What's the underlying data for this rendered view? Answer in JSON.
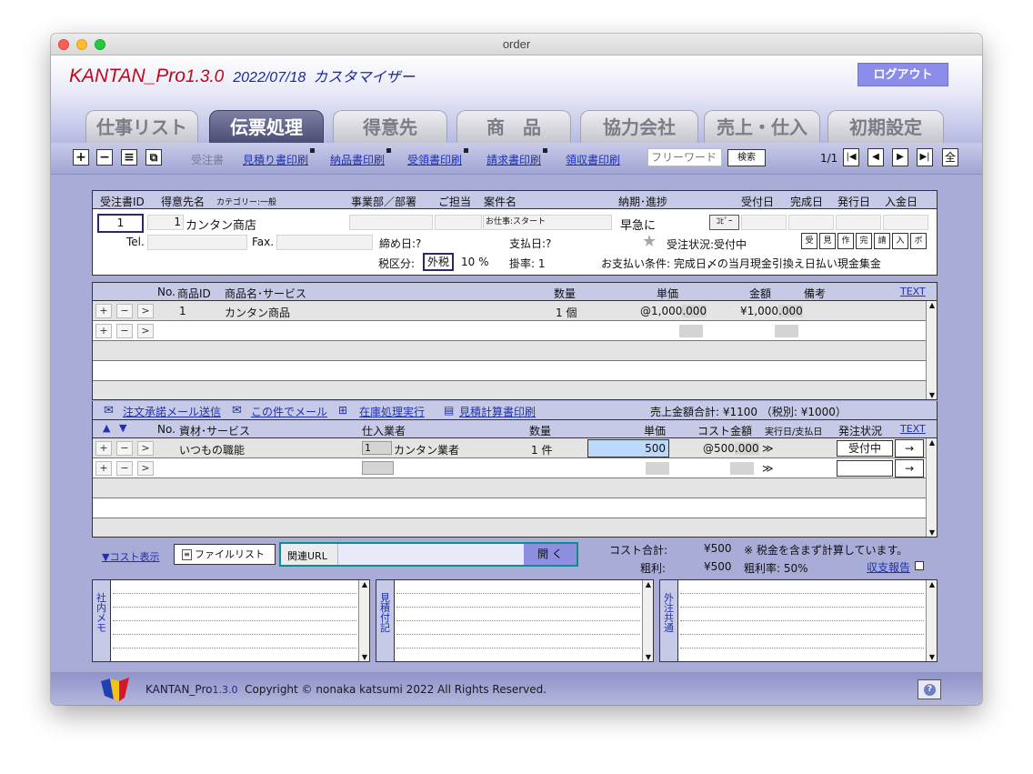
{
  "window": {
    "title": "order"
  },
  "header": {
    "app_name": "KANTAN_Pro",
    "version": "1.3.0",
    "date": "2022/07/18",
    "edition": "カスタマイザー",
    "logout_label": "ログアウト"
  },
  "tabs": [
    {
      "label": "仕事リスト",
      "active": false
    },
    {
      "label": "伝票処理",
      "active": true
    },
    {
      "label": "得意先",
      "active": false
    },
    {
      "label": "商　品",
      "active": false
    },
    {
      "label": "協力会社",
      "active": false
    },
    {
      "label": "売上・仕入",
      "active": false
    },
    {
      "label": "初期設定",
      "active": false
    }
  ],
  "toolbar": {
    "plus": "+",
    "minus": "−",
    "list": "≡",
    "copy": "⧉",
    "order_label": "受注書",
    "links": [
      "見積り書印刷",
      "納品書印刷",
      "受領書印刷",
      "請求書印刷",
      "領収書印刷"
    ],
    "freeword_placeholder": "フリーワード",
    "search_label": "検索",
    "page_info": "1/1",
    "nav_first": "|◀",
    "nav_prev": "◀",
    "nav_next": "▶",
    "nav_last": "▶|",
    "all_label": "全"
  },
  "order": {
    "header": {
      "order_id": "受注書ID",
      "customer": "得意先名",
      "category": "カテゴリー:一般",
      "dept": "事業部／部署",
      "person": "ご担当",
      "case": "案件名",
      "due": "納期･進捗",
      "received": "受付日",
      "completed": "完成日",
      "issued": "発行日",
      "paid": "入金日"
    },
    "order_id_value": "1",
    "customer_id": "1",
    "customer_name": "カンタン商店",
    "case_name": "お仕事:スタート",
    "due_value": "早急に",
    "copy_label": "ｺﾋﾟｰ",
    "tel_label": "Tel.",
    "fax_label": "Fax.",
    "closing_label": "締め日:?",
    "payment_day_label": "支払日:?",
    "status_label": "受注状況:受付中",
    "status_buttons": [
      "受",
      "見",
      "作",
      "完",
      "請",
      "入",
      "ボ"
    ],
    "tax_label": "税区分:",
    "tax_value": "外税",
    "tax_rate": "10 %",
    "rate_label": "掛率: 1",
    "payment_terms": "お支払い条件: 完成日〆の当月現金引換え日払い現金集金"
  },
  "products": {
    "columns": {
      "no": "No.",
      "pid": "商品ID",
      "name": "商品名･サービス",
      "qty": "数量",
      "price": "単価",
      "amount": "金額",
      "note": "備考",
      "text_link": "TEXT"
    },
    "rows": [
      {
        "no": "1",
        "name": "カンタン商品",
        "qty": "1 個",
        "price": "@1,000",
        "price_dec": ".000",
        "amount": "¥1,000",
        "amount_dec": ".000"
      }
    ],
    "row_plus": "+",
    "row_minus": "−",
    "row_go": ">"
  },
  "actions": {
    "mail_accept": "注文承諾メール送信",
    "mail_this": "この件でメール",
    "stock": "在庫処理実行",
    "estimate_print": "見積計算書印刷",
    "sales_total": "売上金額合計: ¥1100 （税別: ¥1000）"
  },
  "costs": {
    "columns": {
      "no": "No.",
      "name": "資材･サービス",
      "vendor": "仕入業者",
      "qty": "数量",
      "price": "単価",
      "cost": "コスト金額",
      "exec": "実行日/支払日",
      "status": "発注状況",
      "text_link": "TEXT"
    },
    "rows": [
      {
        "name": "いつもの職能",
        "vendor_id": "1",
        "vendor": "カンタン業者",
        "qty": "1 件",
        "price": "500",
        "cost": "@500",
        "cost_dec": ".000",
        "exec": "≫",
        "status": "受付中",
        "arrow": "→"
      }
    ],
    "empty_exec": "≫",
    "empty_arrow": "→"
  },
  "bottom": {
    "cost_toggle": "▼コスト表示",
    "file_list": "ファイルリスト",
    "url_label": "関連URL",
    "open_label": "開 く",
    "cost_total_label": "コスト合計:",
    "cost_total": "¥500",
    "cost_note": "※ 税金を含まず計算しています。",
    "profit_label": "粗利:",
    "profit": "¥500",
    "profit_rate": "粗利率: 50%",
    "report_link": "収支報告"
  },
  "memos": [
    "社内メモ",
    "見積付記",
    "外注共通"
  ],
  "footer": {
    "brand": "KANTAN_Pro",
    "version": "1.3.0",
    "copyright": "Copyright © nonaka katsumi 2022 All Rights Reserved.",
    "help": "?"
  },
  "colors": {
    "brand_red": "#c3061a",
    "brand_blue": "#1a2a9c",
    "link_blue": "#1f31b0",
    "bg": "#a9acd6"
  }
}
